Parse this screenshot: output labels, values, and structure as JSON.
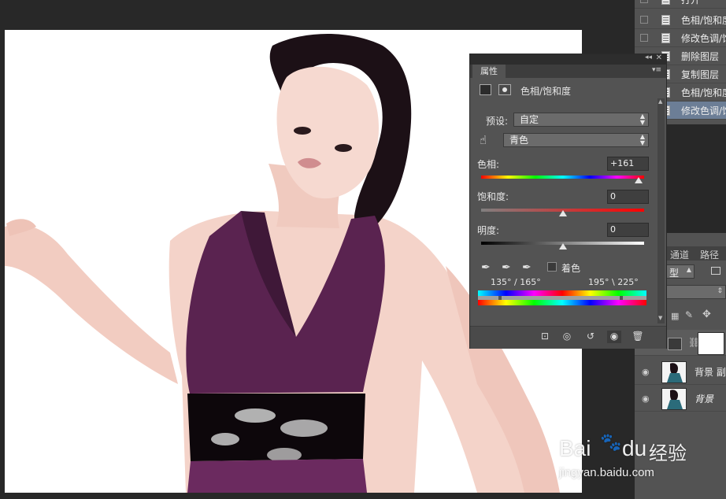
{
  "history": {
    "items": [
      {
        "label": "打开",
        "selected": false
      },
      {
        "label": "色相/饱和度",
        "selected": false
      },
      {
        "label": "修改色调/饱和度",
        "selected": false
      },
      {
        "label": "删除图层",
        "selected": false
      },
      {
        "label": "复制图层",
        "selected": false
      },
      {
        "label": "色相/饱和度",
        "selected": false
      },
      {
        "label": "修改色调/饱和度",
        "selected": true
      }
    ]
  },
  "properties": {
    "tab_label": "属性",
    "adjustment_title": "色相/饱和度",
    "preset_label": "预设:",
    "preset_value": "自定",
    "channel_value": "青色",
    "hue_label": "色相:",
    "hue_value": "+161",
    "saturation_label": "饱和度:",
    "saturation_value": "0",
    "lightness_label": "明度:",
    "lightness_value": "0",
    "colorize_label": "着色",
    "range_left": "135° / 165°",
    "range_right": "195° \\ 225°"
  },
  "layers": {
    "tabs": [
      "通道",
      "路径"
    ],
    "filter_partial": "型",
    "items": [
      {
        "name": "",
        "type": "adjustment"
      },
      {
        "name": "背景 副",
        "type": "photo"
      },
      {
        "name": "背景",
        "type": "photo",
        "italic": true
      }
    ]
  },
  "watermark": {
    "brand": "Bai",
    "brand2": "du",
    "brand_cn": "经验",
    "url": "jingyan.baidu.com"
  },
  "colors": {
    "app_bg": "#282828",
    "panel_bg": "#535353",
    "selection": "#6c7e96",
    "dress": "#5a2350"
  },
  "icons": {
    "hand_tool": "targeted-adjustment-hand-icon",
    "eyedropper": "eyedropper-icon",
    "eye": "visibility-eye-icon"
  }
}
